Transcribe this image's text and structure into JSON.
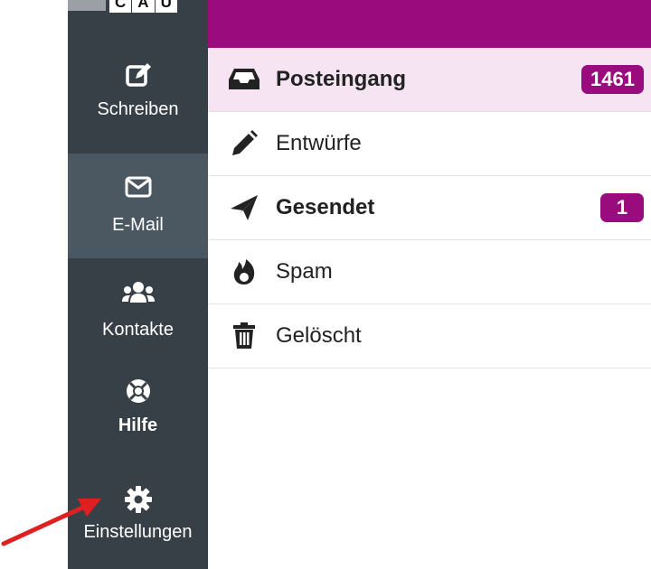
{
  "logo": {
    "letters": [
      "C",
      "A",
      "U"
    ]
  },
  "sidebar": {
    "items": [
      {
        "label": "Schreiben",
        "icon": "compose-icon"
      },
      {
        "label": "E-Mail",
        "icon": "envelope-icon"
      },
      {
        "label": "Kontakte",
        "icon": "users-icon"
      },
      {
        "label": "Hilfe",
        "icon": "lifebuoy-icon"
      },
      {
        "label": "Einstellungen",
        "icon": "gear-icon"
      }
    ]
  },
  "folders": [
    {
      "label": "Posteingang",
      "icon": "inbox-icon",
      "badge": "1461"
    },
    {
      "label": "Entwürfe",
      "icon": "pencil-icon"
    },
    {
      "label": "Gesendet",
      "icon": "paper-plane-icon",
      "badge": "1"
    },
    {
      "label": "Spam",
      "icon": "fire-icon"
    },
    {
      "label": "Gelöscht",
      "icon": "trash-icon"
    }
  ],
  "colors": {
    "accent": "#9a0c7e",
    "sidebar_bg": "#384047",
    "sidebar_active": "#4b5861",
    "selected_row": "#f6e4f2",
    "annotation_arrow": "#e02020"
  }
}
